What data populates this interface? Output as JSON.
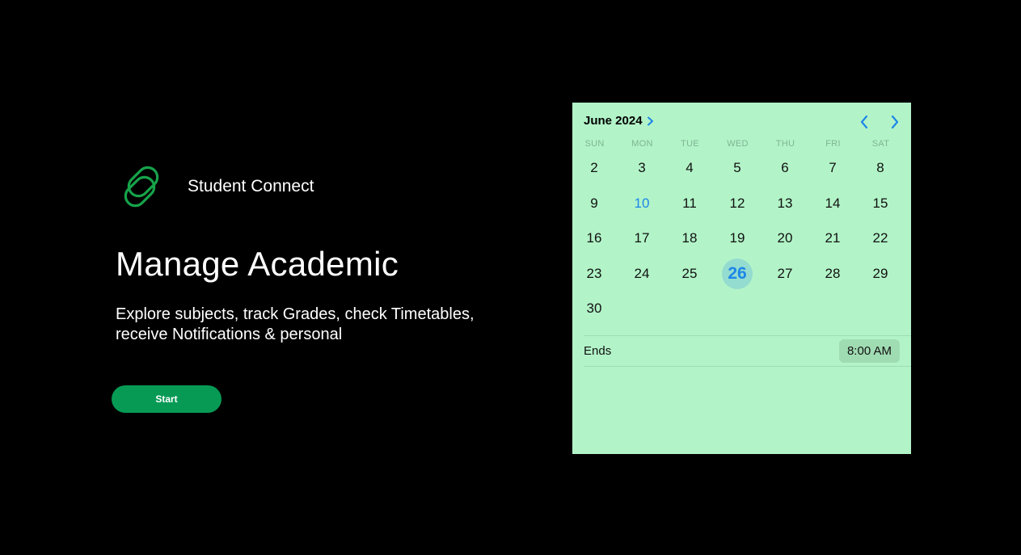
{
  "brand": {
    "name": "Student Connect",
    "logo_icon": "link-icon",
    "logo_color": "#16a34a"
  },
  "hero": {
    "title": "Manage Academic",
    "description": "Explore subjects, track Grades, check Timetables, receive Notifications & personal",
    "start_label": "Start",
    "button_color": "#079a55"
  },
  "calendar": {
    "month_label": "June 2024",
    "prev_icon": "chevron-left-icon",
    "next_icon": "chevron-right-icon",
    "weekdays": [
      "SUN",
      "MON",
      "TUE",
      "WED",
      "THU",
      "FRI",
      "SAT"
    ],
    "weeks": [
      [
        "",
        "",
        "",
        "",
        "",
        "",
        ""
      ],
      [
        "2",
        "3",
        "4",
        "5",
        "6",
        "7",
        "8"
      ],
      [
        "9",
        "10",
        "11",
        "12",
        "13",
        "14",
        "15"
      ],
      [
        "16",
        "17",
        "18",
        "19",
        "20",
        "21",
        "22"
      ],
      [
        "23",
        "24",
        "25",
        "26",
        "27",
        "28",
        "29"
      ],
      [
        "30",
        "",
        "",
        "",
        "",
        "",
        ""
      ]
    ],
    "today": "10",
    "selected": "26",
    "ends_label": "Ends",
    "ends_time": "8:00 AM",
    "background_color": "#b2f4c8",
    "accent_color": "#1d86e8"
  }
}
